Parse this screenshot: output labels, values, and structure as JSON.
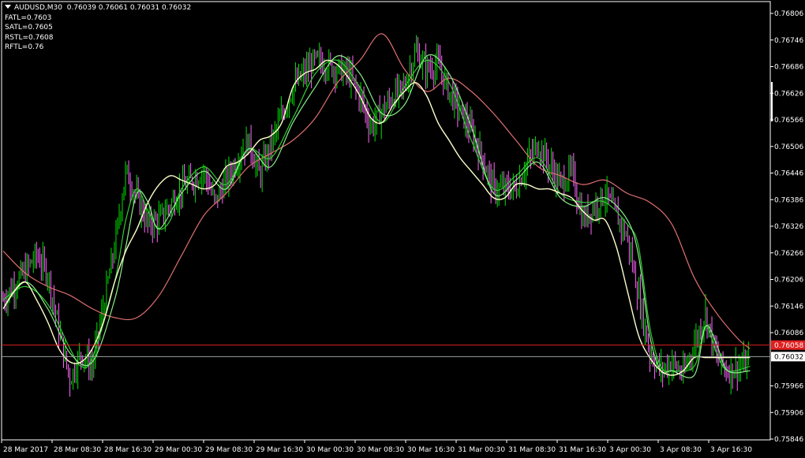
{
  "header": {
    "symbol": "AUDUSD,M30",
    "ohlc": "0.76039 0.76061 0.76031 0.76032",
    "indicators": [
      "FATL=0.7603",
      "SATL=0.7605",
      "RSTL=0.7608",
      "RFTL=0.76"
    ]
  },
  "colors": {
    "background": "#000000",
    "axis": "#ffffff",
    "bull_bar": "#00e000",
    "bear_bar": "#ff66ff",
    "fatl": "#ffffcc",
    "satl": "#33cc33",
    "rstl": "#e07070",
    "rftl": "#88ee88",
    "bid_line": "#e02020",
    "ask_line": "#9aa0a0"
  },
  "chart_data": {
    "type": "line",
    "title": "AUDUSD,M30",
    "ylim": [
      0.75846,
      0.76806
    ],
    "y_ticks": [
      "0.76806",
      "0.76746",
      "0.76686",
      "0.76626",
      "0.76566",
      "0.76506",
      "0.76446",
      "0.76386",
      "0.76326",
      "0.76266",
      "0.76206",
      "0.76146",
      "0.76086",
      "0.76032",
      "0.75966",
      "0.75906",
      "0.75846"
    ],
    "x_ticks": [
      "28 Mar 2017",
      "28 Mar 08:30",
      "28 Mar 16:30",
      "29 Mar 00:30",
      "29 Mar 08:30",
      "29 Mar 16:30",
      "30 Mar 00:30",
      "30 Mar 08:30",
      "30 Mar 16:30",
      "31 Mar 00:30",
      "31 Mar 08:30",
      "31 Mar 16:30",
      "3 Apr 00:30",
      "3 Apr 08:30",
      "3 Apr 16:30"
    ],
    "price_labels": [
      {
        "value": 0.76058,
        "label": "0.76058",
        "color": "#e02020",
        "text_color": "#ffffff"
      },
      {
        "value": 0.76032,
        "label": "0.76032",
        "color": "#ffffff",
        "text_color": "#000000"
      }
    ],
    "price_path": [
      [
        0,
        0.7616
      ],
      [
        3,
        0.7626
      ],
      [
        4,
        0.7622
      ],
      [
        5,
        0.7609
      ],
      [
        6,
        0.7598
      ],
      [
        7,
        0.7604
      ],
      [
        8,
        0.7601
      ],
      [
        10,
        0.7628
      ],
      [
        11,
        0.7645
      ],
      [
        12,
        0.7639
      ],
      [
        13,
        0.7633
      ],
      [
        14,
        0.7634
      ],
      [
        16,
        0.7641
      ],
      [
        18,
        0.7645
      ],
      [
        19,
        0.7638
      ],
      [
        20,
        0.7643
      ],
      [
        22,
        0.7652
      ],
      [
        23,
        0.7644
      ],
      [
        24,
        0.7651
      ],
      [
        26,
        0.7664
      ],
      [
        28,
        0.767
      ],
      [
        29,
        0.7669
      ],
      [
        31,
        0.7667
      ],
      [
        32,
        0.7662
      ],
      [
        33,
        0.7655
      ],
      [
        35,
        0.7662
      ],
      [
        36,
        0.7664
      ],
      [
        37,
        0.7672
      ],
      [
        38,
        0.7668
      ],
      [
        39,
        0.7669
      ],
      [
        40,
        0.7663
      ],
      [
        42,
        0.7654
      ],
      [
        43,
        0.7648
      ],
      [
        44,
        0.7641
      ],
      [
        46,
        0.7641
      ],
      [
        47,
        0.7647
      ],
      [
        48,
        0.7651
      ],
      [
        50,
        0.7642
      ],
      [
        51,
        0.7645
      ],
      [
        52,
        0.7634
      ],
      [
        53,
        0.7637
      ],
      [
        54,
        0.764
      ],
      [
        56,
        0.763
      ],
      [
        57,
        0.7617
      ],
      [
        58,
        0.7604
      ],
      [
        59,
        0.76
      ],
      [
        60,
        0.7602
      ],
      [
        61,
        0.7599
      ],
      [
        62,
        0.7606
      ],
      [
        63,
        0.7613
      ],
      [
        64,
        0.7603
      ],
      [
        65,
        0.76
      ],
      [
        66,
        0.7601
      ],
      [
        67,
        0.7602
      ]
    ],
    "series": [
      {
        "name": "FATL",
        "values": [
          [
            0,
            0.7614
          ],
          [
            1,
            0.7618
          ],
          [
            2,
            0.762
          ],
          [
            3,
            0.7616
          ],
          [
            4,
            0.7611
          ],
          [
            5,
            0.7605
          ],
          [
            6,
            0.7602
          ],
          [
            7,
            0.7602
          ],
          [
            8,
            0.7605
          ],
          [
            9,
            0.7611
          ],
          [
            10,
            0.762
          ],
          [
            11,
            0.7627
          ],
          [
            12,
            0.7632
          ],
          [
            13,
            0.7638
          ],
          [
            14,
            0.7642
          ],
          [
            15,
            0.7644
          ],
          [
            16,
            0.7643
          ],
          [
            17,
            0.7642
          ],
          [
            18,
            0.7641
          ],
          [
            19,
            0.7642
          ],
          [
            20,
            0.7646
          ],
          [
            21,
            0.7647
          ],
          [
            22,
            0.7649
          ],
          [
            23,
            0.7652
          ],
          [
            24,
            0.7653
          ],
          [
            25,
            0.7656
          ],
          [
            26,
            0.7664
          ],
          [
            27,
            0.7667
          ],
          [
            28,
            0.7668
          ],
          [
            29,
            0.767
          ],
          [
            30,
            0.7669
          ],
          [
            31,
            0.7666
          ],
          [
            32,
            0.7662
          ],
          [
            33,
            0.7657
          ],
          [
            34,
            0.7656
          ],
          [
            35,
            0.766
          ],
          [
            36,
            0.7663
          ],
          [
            37,
            0.7665
          ],
          [
            38,
            0.7662
          ],
          [
            39,
            0.7656
          ],
          [
            40,
            0.7652
          ],
          [
            41,
            0.7648
          ],
          [
            42,
            0.7645
          ],
          [
            43,
            0.7642
          ],
          [
            44,
            0.7639
          ],
          [
            45,
            0.7639
          ],
          [
            46,
            0.7642
          ],
          [
            47,
            0.7642
          ],
          [
            48,
            0.7641
          ],
          [
            49,
            0.7641
          ],
          [
            50,
            0.764
          ],
          [
            51,
            0.7639
          ],
          [
            52,
            0.7636
          ],
          [
            53,
            0.7634
          ],
          [
            54,
            0.7634
          ],
          [
            55,
            0.7628
          ],
          [
            56,
            0.7618
          ],
          [
            57,
            0.7608
          ],
          [
            58,
            0.7603
          ],
          [
            59,
            0.76
          ],
          [
            60,
            0.7599
          ],
          [
            61,
            0.76
          ],
          [
            62,
            0.7603
          ],
          [
            63,
            0.7603
          ],
          [
            64,
            0.7603
          ],
          [
            65,
            0.7603
          ],
          [
            66,
            0.7603
          ],
          [
            67,
            0.7603
          ]
        ]
      },
      {
        "name": "SATL",
        "values": [
          [
            0,
            0.7616
          ],
          [
            2,
            0.7619
          ],
          [
            4,
            0.7615
          ],
          [
            6,
            0.7605
          ],
          [
            7,
            0.7601
          ],
          [
            8,
            0.7603
          ],
          [
            10,
            0.762
          ],
          [
            11,
            0.7634
          ],
          [
            12,
            0.7641
          ],
          [
            13,
            0.7636
          ],
          [
            14,
            0.7632
          ],
          [
            15,
            0.7634
          ],
          [
            16,
            0.7641
          ],
          [
            18,
            0.7646
          ],
          [
            20,
            0.7642
          ],
          [
            22,
            0.765
          ],
          [
            24,
            0.7648
          ],
          [
            26,
            0.7657
          ],
          [
            28,
            0.7667
          ],
          [
            30,
            0.767
          ],
          [
            32,
            0.7664
          ],
          [
            34,
            0.7656
          ],
          [
            36,
            0.7664
          ],
          [
            38,
            0.767
          ],
          [
            40,
            0.7665
          ],
          [
            42,
            0.7652
          ],
          [
            44,
            0.7641
          ],
          [
            46,
            0.7644
          ],
          [
            48,
            0.7648
          ],
          [
            50,
            0.764
          ],
          [
            52,
            0.7638
          ],
          [
            54,
            0.7638
          ],
          [
            56,
            0.7633
          ],
          [
            57,
            0.7628
          ],
          [
            58,
            0.761
          ],
          [
            59,
            0.7601
          ],
          [
            60,
            0.76
          ],
          [
            62,
            0.7601
          ],
          [
            63,
            0.761
          ],
          [
            64,
            0.7604
          ],
          [
            65,
            0.76
          ],
          [
            67,
            0.7601
          ]
        ]
      },
      {
        "name": "RSTL",
        "values": [
          [
            0,
            0.7627
          ],
          [
            2,
            0.7622
          ],
          [
            4,
            0.7619
          ],
          [
            6,
            0.7617
          ],
          [
            8,
            0.7614
          ],
          [
            10,
            0.7612
          ],
          [
            12,
            0.7612
          ],
          [
            14,
            0.7617
          ],
          [
            16,
            0.7626
          ],
          [
            18,
            0.7635
          ],
          [
            20,
            0.764
          ],
          [
            22,
            0.7646
          ],
          [
            24,
            0.7649
          ],
          [
            26,
            0.7652
          ],
          [
            28,
            0.7657
          ],
          [
            30,
            0.7665
          ],
          [
            32,
            0.767
          ],
          [
            34,
            0.7676
          ],
          [
            36,
            0.7668
          ],
          [
            38,
            0.7663
          ],
          [
            40,
            0.7666
          ],
          [
            42,
            0.7663
          ],
          [
            44,
            0.7658
          ],
          [
            46,
            0.7652
          ],
          [
            48,
            0.7646
          ],
          [
            50,
            0.7644
          ],
          [
            52,
            0.7642
          ],
          [
            54,
            0.7643
          ],
          [
            56,
            0.764
          ],
          [
            58,
            0.7638
          ],
          [
            60,
            0.7633
          ],
          [
            62,
            0.7621
          ],
          [
            64,
            0.7613
          ],
          [
            66,
            0.7607
          ],
          [
            67,
            0.7605
          ]
        ]
      },
      {
        "name": "RFTL",
        "values": [
          [
            0,
            0.7614
          ],
          [
            2,
            0.762
          ],
          [
            4,
            0.7614
          ],
          [
            6,
            0.7604
          ],
          [
            8,
            0.7602
          ],
          [
            10,
            0.7616
          ],
          [
            11,
            0.7628
          ],
          [
            12,
            0.764
          ],
          [
            13,
            0.7638
          ],
          [
            14,
            0.7632
          ],
          [
            16,
            0.764
          ],
          [
            18,
            0.7645
          ],
          [
            20,
            0.7641
          ],
          [
            22,
            0.765
          ],
          [
            24,
            0.7646
          ],
          [
            26,
            0.7656
          ],
          [
            28,
            0.7664
          ],
          [
            30,
            0.7671
          ],
          [
            32,
            0.7667
          ],
          [
            34,
            0.7658
          ],
          [
            36,
            0.766
          ],
          [
            38,
            0.7671
          ],
          [
            40,
            0.7667
          ],
          [
            42,
            0.7655
          ],
          [
            44,
            0.764
          ],
          [
            46,
            0.7643
          ],
          [
            48,
            0.7647
          ],
          [
            50,
            0.7639
          ],
          [
            52,
            0.7637
          ],
          [
            54,
            0.7639
          ],
          [
            56,
            0.7634
          ],
          [
            57,
            0.7626
          ],
          [
            58,
            0.7608
          ],
          [
            59,
            0.76
          ],
          [
            60,
            0.76
          ],
          [
            62,
            0.7599
          ],
          [
            63,
            0.761
          ],
          [
            64,
            0.7606
          ],
          [
            65,
            0.76
          ],
          [
            67,
            0.76
          ]
        ]
      }
    ]
  }
}
